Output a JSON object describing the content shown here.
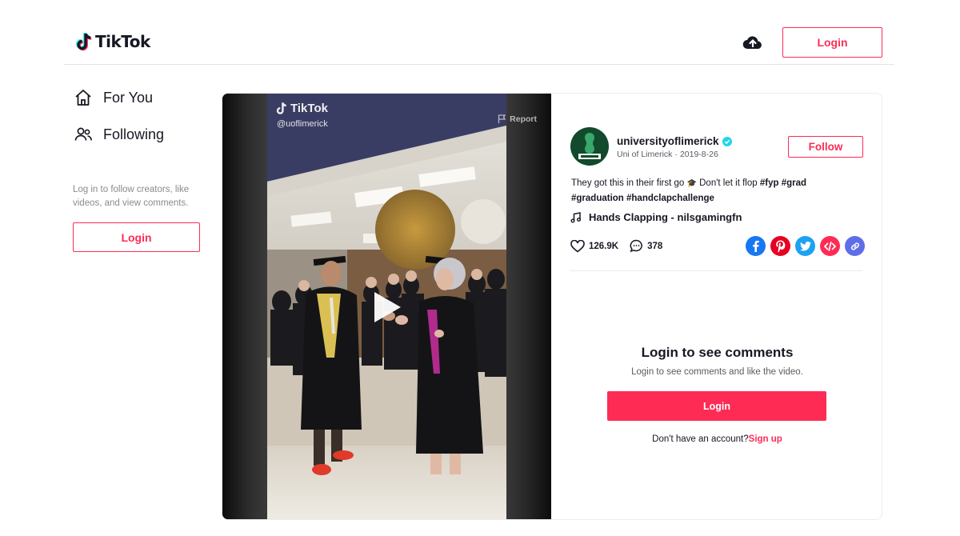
{
  "header": {
    "logo_text": "TikTok",
    "login_label": "Login",
    "upload_icon": "cloud-upload-icon"
  },
  "sidebar": {
    "items": [
      {
        "label": "For You",
        "icon": "home-icon"
      },
      {
        "label": "Following",
        "icon": "users-icon"
      }
    ],
    "hint": "Log in to follow creators, like videos, and view comments.",
    "login_label": "Login"
  },
  "video": {
    "watermark_logo": "TikTok",
    "watermark_user": "@uoflimerick",
    "report_label": "Report",
    "play_icon": "play-icon"
  },
  "post": {
    "username": "universityoflimerick",
    "verified": true,
    "display_name": "Uni of Limerick",
    "separator": "·",
    "date": "2019-8-26",
    "follow_label": "Follow",
    "caption": "They got this in their first go",
    "caption_emoji": "🎓",
    "caption_tail": "Don't let it flop",
    "hashtags": [
      "#fyp",
      "#grad",
      "#graduation",
      "#handclapchallenge"
    ],
    "music": "Hands Clapping - nilsgamingfn",
    "likes": "126.9K",
    "comments": "378"
  },
  "share": [
    {
      "name": "facebook",
      "color": "#1877f2",
      "glyph": "f"
    },
    {
      "name": "pinterest",
      "color": "#e60023",
      "glyph": "P"
    },
    {
      "name": "twitter",
      "color": "#1da1f2",
      "glyph": "t"
    },
    {
      "name": "embed",
      "color": "#fe2c55",
      "glyph": "</>"
    },
    {
      "name": "copy-link",
      "color": "#5e6ee8",
      "glyph": "∞"
    }
  ],
  "comments_panel": {
    "title": "Login to see comments",
    "subtitle": "Login to see comments and like the video.",
    "login_label": "Login",
    "no_account": "Don't have an account?",
    "signup_label": "Sign up"
  },
  "colors": {
    "accent": "#fe2c55",
    "text": "#161823",
    "muted": "#8a8b91",
    "verified": "#20d5ec"
  }
}
